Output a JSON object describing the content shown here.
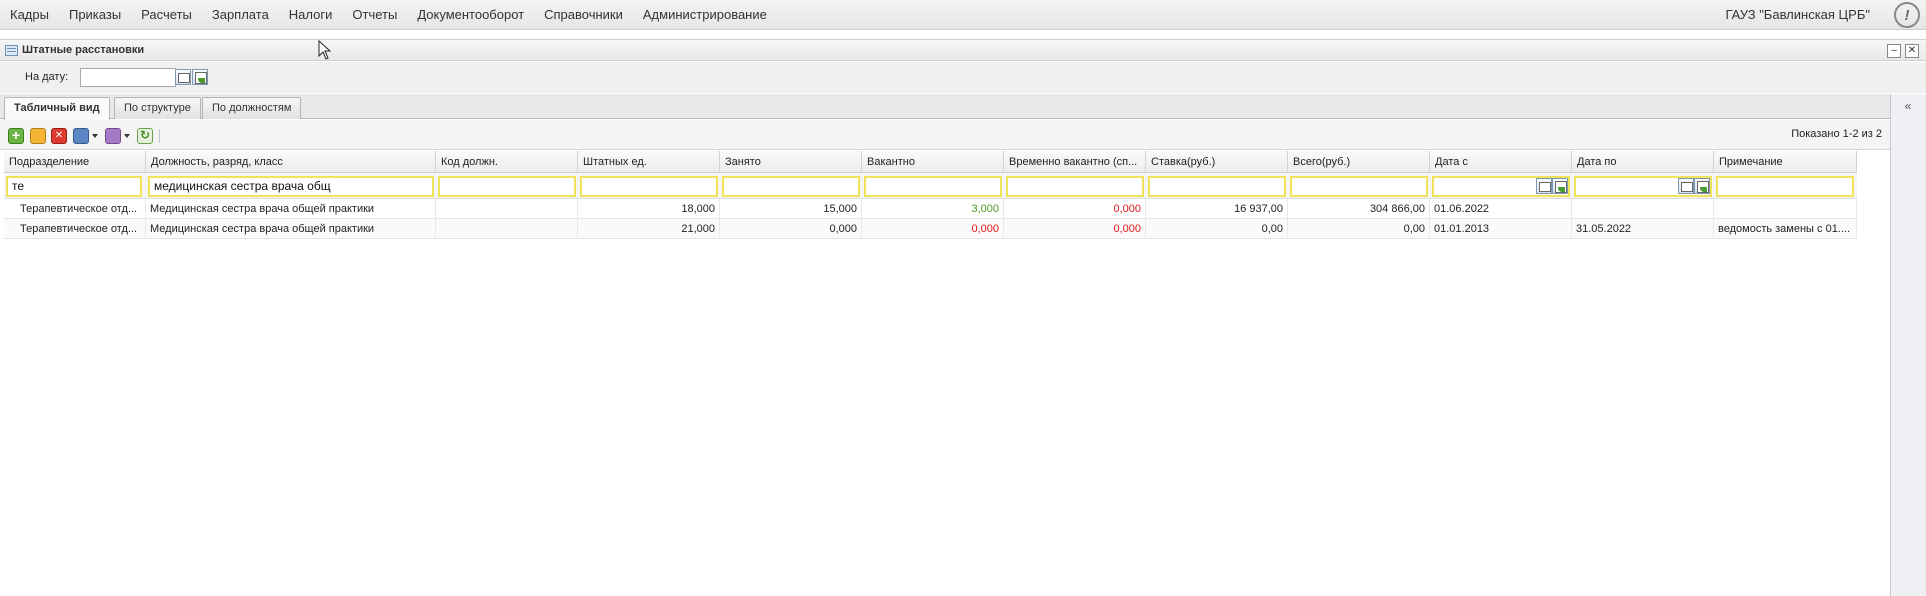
{
  "menu": {
    "items": [
      "Кадры",
      "Приказы",
      "Расчеты",
      "Зарплата",
      "Налоги",
      "Отчеты",
      "Документооборот",
      "Справочники",
      "Администрирование"
    ],
    "org": "ГАУЗ \"Бавлинская ЦРБ\"",
    "info_icon": "info-circle-icon",
    "info_glyph": "!"
  },
  "window": {
    "title": "Штатные расстановки",
    "minimize": "–",
    "close": "✕"
  },
  "date_filter": {
    "label": "На дату:",
    "value": ""
  },
  "tabs": [
    {
      "label": "Табличный вид",
      "active": true
    },
    {
      "label": "По структуре",
      "active": false
    },
    {
      "label": "По должностям",
      "active": false
    }
  ],
  "collapse_glyph": "«",
  "toolbar": {
    "shown": "Показано 1-2 из 2",
    "icons": [
      "add-icon",
      "edit-icon",
      "delete-icon",
      "print-icon",
      "settings-icon",
      "refresh-icon"
    ]
  },
  "grid": {
    "columns": [
      "Подразделение",
      "Должность, разряд, класс",
      "Код должн.",
      "Штатных ед.",
      "Занято",
      "Вакантно",
      "Временно вакантно (сп...",
      "Ставка(руб.)",
      "Всего(руб.)",
      "Дата с",
      "Дата по",
      "Примечание"
    ],
    "filters": [
      "те",
      "медицинская сестра врача общ",
      "",
      "",
      "",
      "",
      "",
      "",
      "",
      "",
      "",
      ""
    ],
    "rows": [
      [
        "Терапевтическое отд...",
        "Медицинская сестра врача общей практики",
        "",
        "18,000",
        "15,000",
        "3,000",
        "0,000",
        "16 937,00",
        "304 866,00",
        "01.06.2022",
        "",
        ""
      ],
      [
        "Терапевтическое отд...",
        "Медицинская сестра врача общей практики",
        "",
        "21,000",
        "0,000",
        "0,000",
        "0,000",
        "0,00",
        "0,00",
        "01.01.2013",
        "31.05.2022",
        "ведомость замены с 01...."
      ]
    ]
  },
  "colors": {
    "vacant_positive": "#4d9a22",
    "vacant_zero": "#e01818",
    "filter_border": "#efe35a"
  }
}
